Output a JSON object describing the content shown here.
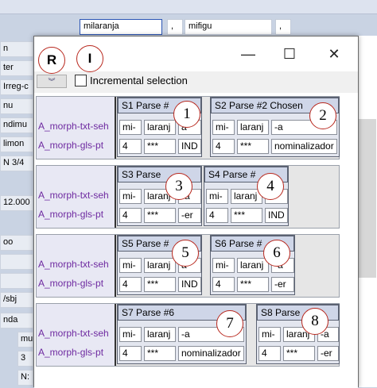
{
  "background": {
    "top_cells": [
      "milaranja",
      ",",
      "mifigu",
      ","
    ],
    "left_items": [
      "n",
      "ter",
      "Irreg-c",
      "nu",
      "ndimu",
      "limon",
      "N 3/4",
      "12.000",
      "oo",
      "",
      "",
      "/sbj",
      "nda",
      "mu",
      "3",
      "N:"
    ]
  },
  "dialog": {
    "title_marks": {
      "r": "R",
      "i": "I"
    },
    "titlebar": {
      "minimize": "—",
      "maximize": "☐",
      "close": "✕"
    },
    "collapse_glyph": "︾",
    "incremental_label": "Incremental selection",
    "row_labels": {
      "txt": "A_morph-txt-seh",
      "gls": "A_morph-gls-pt"
    },
    "groups": [
      {
        "parses": [
          {
            "header": "S1 Parse #",
            "marker": "1",
            "txt": [
              "mi-",
              "laranj",
              "a"
            ],
            "gls": [
              "4",
              "***",
              "IND"
            ]
          },
          {
            "header": "S2 Parse #2 Chosen",
            "marker": "2",
            "txt": [
              "mi-",
              "laranj",
              "-a"
            ],
            "gls": [
              "4",
              "***",
              "nominalizador"
            ]
          }
        ]
      },
      {
        "parses": [
          {
            "header": "S3 Parse",
            "marker": "3",
            "txt": [
              "mi-",
              "laranj",
              "-a"
            ],
            "gls": [
              "4",
              "***",
              "-er"
            ]
          },
          {
            "header": "S4 Parse #",
            "marker": "4",
            "txt": [
              "mi-",
              "laranj",
              "a"
            ],
            "gls": [
              "4",
              "***",
              "IND"
            ]
          }
        ]
      },
      {
        "parses": [
          {
            "header": "S5 Parse #",
            "marker": "5",
            "txt": [
              "mi-",
              "laranj",
              "a"
            ],
            "gls": [
              "4",
              "***",
              "IND"
            ]
          },
          {
            "header": "S6 Parse #",
            "marker": "6",
            "txt": [
              "mi-",
              "laranj",
              "-a"
            ],
            "gls": [
              "4",
              "***",
              "-er"
            ]
          }
        ]
      },
      {
        "parses": [
          {
            "header": "S7 Parse #6",
            "marker": "7",
            "txt": [
              "mi-",
              "laranj",
              "-a"
            ],
            "gls": [
              "4",
              "***",
              "nominalizador"
            ]
          },
          {
            "header": "S8 Parse",
            "marker": "8",
            "txt": [
              "mi-",
              "laranj",
              "-a"
            ],
            "gls": [
              "4",
              "***",
              "-er"
            ]
          }
        ]
      }
    ]
  }
}
